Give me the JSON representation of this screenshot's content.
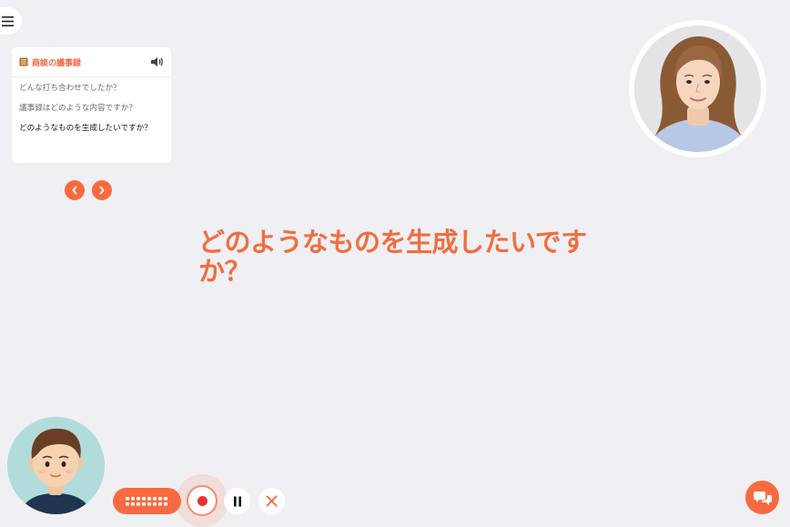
{
  "menu": {
    "icon": "hamburger-menu-icon"
  },
  "card": {
    "title_icon": "notebook-icon",
    "title": "商談の議事録",
    "speaker_icon": "speaker-icon",
    "questions": [
      "どんな打ち合わせでしたか？",
      "議事録はどのような内容ですか？",
      "どのようなものを生成したいですか？"
    ],
    "active_index": 2
  },
  "nav": {
    "prev_icon": "chevron-left-icon",
    "next_icon": "chevron-right-icon"
  },
  "current_question": "どのようなものを生成したいですか？",
  "agent_avatar": {
    "icon": "agent-portrait"
  },
  "user_avatar": {
    "icon": "user-avatar-illustration"
  },
  "controls": {
    "keyboard_icon": "keyboard-icon",
    "record_icon": "record-icon",
    "pause_icon": "pause-icon",
    "close_icon": "close-icon",
    "chat_icon": "chat-bubbles-icon"
  },
  "colors": {
    "accent": "#fa6a40",
    "question_text": "#f26d3f",
    "background": "#f0f0f4",
    "record": "#e8322e"
  }
}
